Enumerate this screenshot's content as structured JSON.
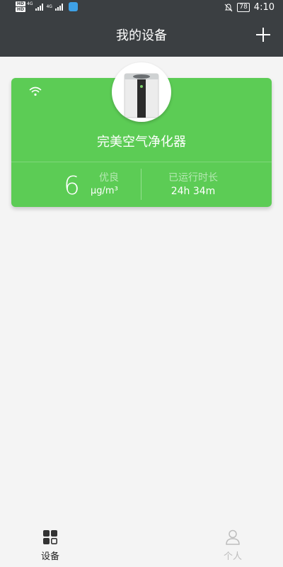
{
  "status_bar": {
    "sim1": "HD",
    "sim1_net": "4G",
    "sim2": "HD",
    "sim2_net": "4G",
    "battery": "78",
    "time": "4:10",
    "icons": [
      "signal-icon",
      "notifications-muted-icon",
      "battery-icon"
    ]
  },
  "app_bar": {
    "title": "我的设备",
    "add_icon": "plus-icon"
  },
  "device_card": {
    "name": "完美空气净化器",
    "connection_icon": "wifi-icon",
    "pm_value": "6",
    "air_quality": "优良",
    "pm_unit": "μg/m³",
    "runtime_label": "已运行时长",
    "runtime_value": "24h 34m",
    "color": "#5ccc55"
  },
  "bottom_nav": {
    "items": [
      {
        "label": "设备",
        "icon": "grid-icon",
        "active": true
      },
      {
        "label": "个人",
        "icon": "person-icon",
        "active": false
      }
    ]
  },
  "colors": {
    "app_bar": "#3b3f42",
    "background": "#f4f4f4",
    "inactive_nav": "#bdbdbd"
  }
}
